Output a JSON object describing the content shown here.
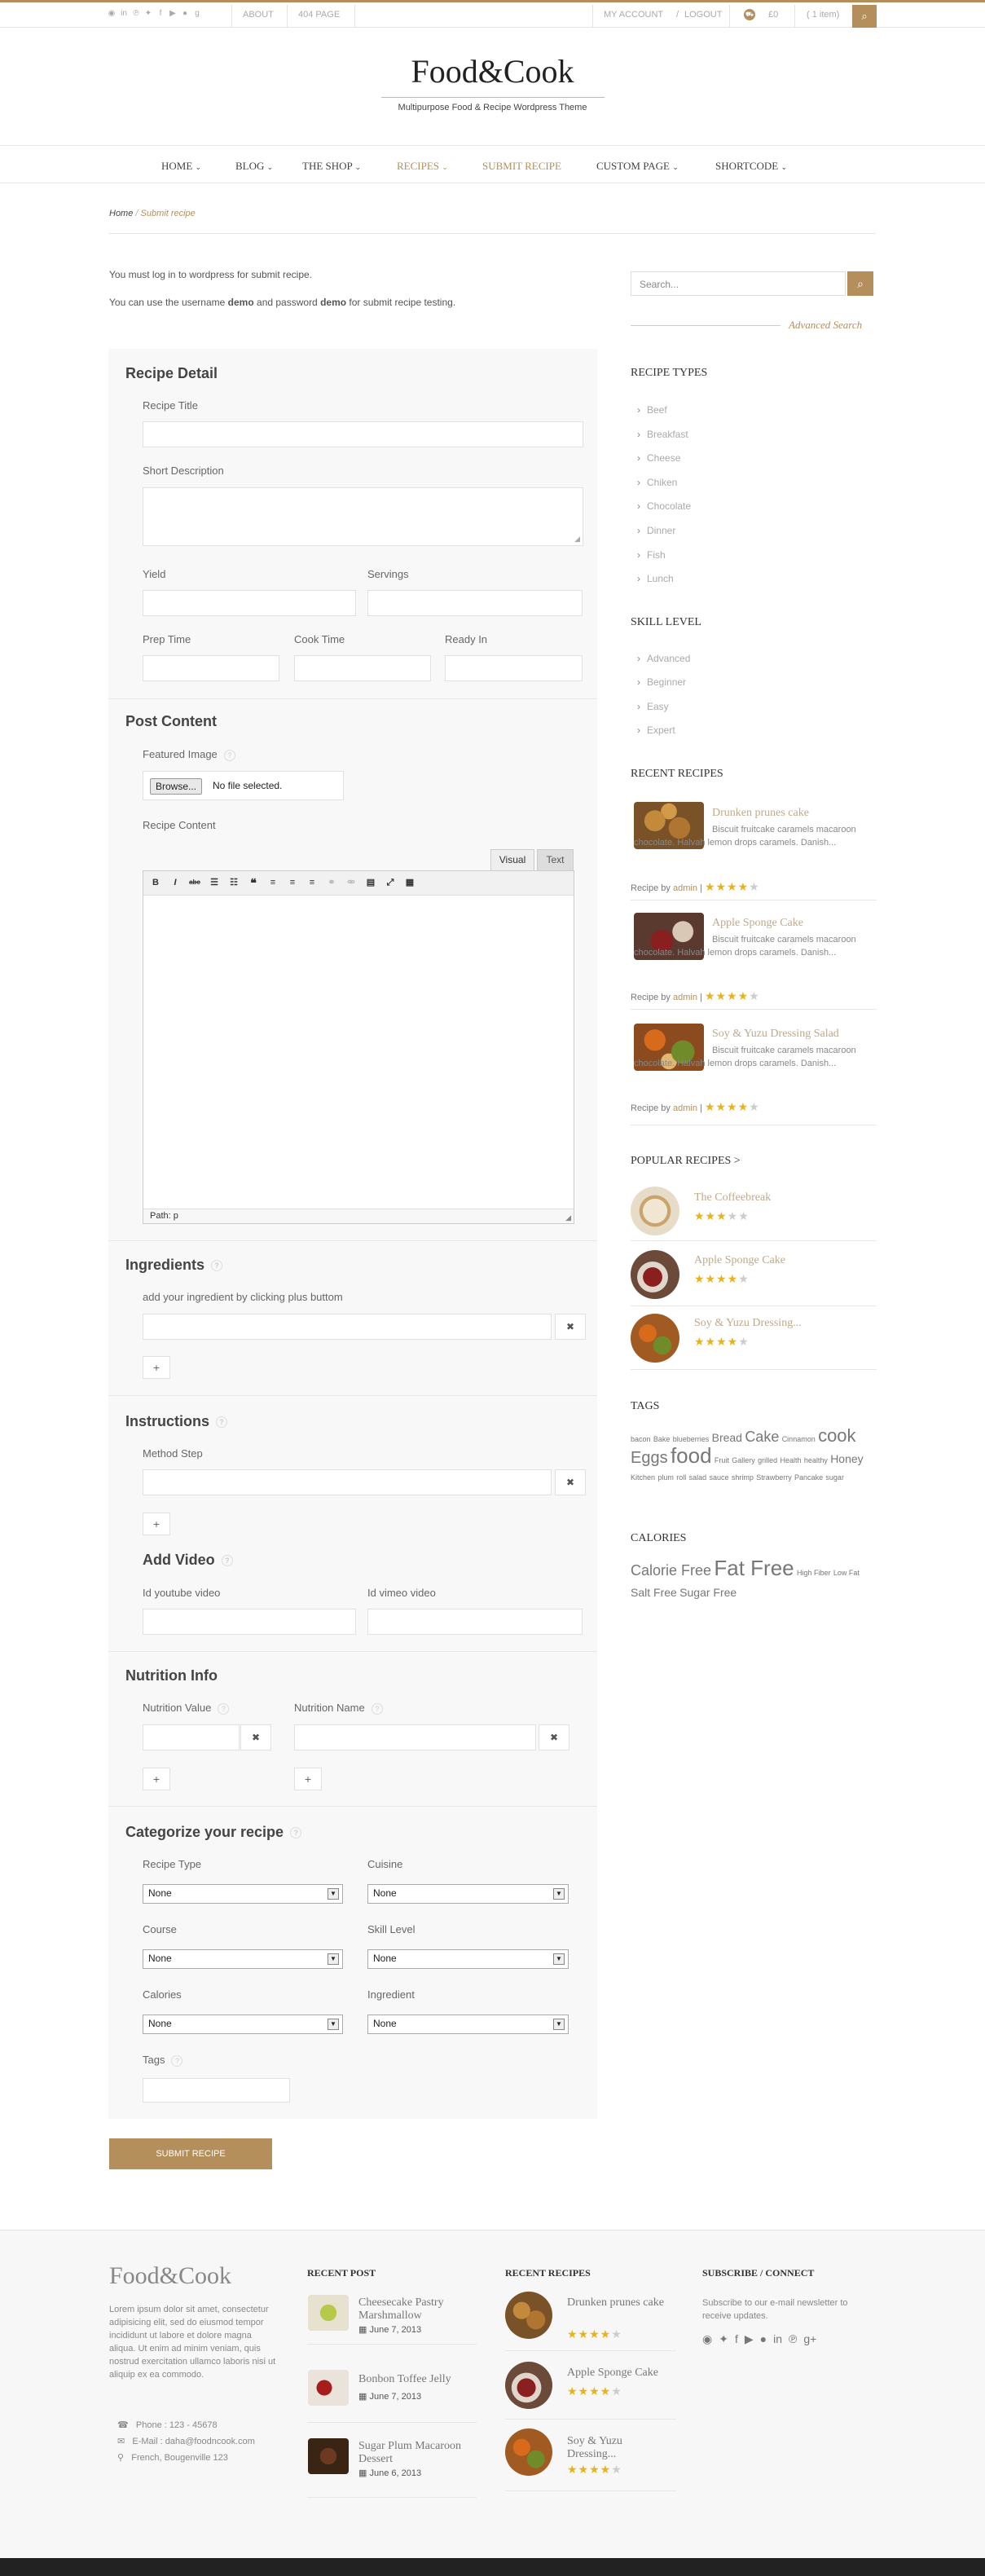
{
  "topbar": {
    "social_icons": [
      "rss-icon",
      "linkedin-icon",
      "pinterest-icon",
      "twitter-icon",
      "facebook-icon",
      "youtube-icon",
      "flickr-icon",
      "google-plus-icon"
    ],
    "links": [
      "ABOUT",
      "404 PAGE"
    ],
    "my_account": "MY ACCOUNT",
    "separator": "/",
    "logout": "LOGOUT",
    "cart_total": "£0",
    "cart_items": "( 1 item)"
  },
  "brand": {
    "logo": "Food&Cook",
    "tagline": "Multipurpose Food & Recipe Wordpress Theme"
  },
  "nav": {
    "items": [
      "HOME",
      "BLOG",
      "THE SHOP",
      "RECIPES",
      "SUBMIT RECIPE",
      "CUSTOM PAGE",
      "SHORTCODE"
    ]
  },
  "breadcrumb": {
    "home": "Home",
    "separator": "/",
    "current": "Submit recipe"
  },
  "notice": {
    "line1": "You must log in to wordpress for submit recipe.",
    "line2_a": "You can use the username ",
    "line2_user": "demo",
    "line2_b": " and password ",
    "line2_pass": "demo",
    "line2_c": " for submit recipe testing."
  },
  "form": {
    "recipe_detail": {
      "title": "Recipe Detail",
      "recipe_title": "Recipe Title",
      "short_description": "Short Description",
      "yield": "Yield",
      "servings": "Servings",
      "prep_time": "Prep Time",
      "cook_time": "Cook Time",
      "ready_in": "Ready In"
    },
    "post_content": {
      "title": "Post Content",
      "featured_image": "Featured Image",
      "browse": "Browse...",
      "no_file": "No file selected.",
      "recipe_content": "Recipe Content",
      "visual_tab": "Visual",
      "text_tab": "Text",
      "path": "Path: p",
      "help": "?"
    },
    "ingredients": {
      "title": "Ingredients",
      "hint": "add your ingredient by clicking plus buttom",
      "remove": "✖",
      "add": "+"
    },
    "instructions": {
      "title": "Instructions",
      "method_step": "Method Step"
    },
    "video": {
      "title": "Add Video",
      "youtube": "Id youtube video",
      "vimeo": "Id vimeo video"
    },
    "nutrition": {
      "title": "Nutrition Info",
      "value": "Nutrition Value",
      "name": "Nutrition Name"
    },
    "categorize": {
      "title": "Categorize your recipe",
      "recipe_type": "Recipe Type",
      "cuisine": "Cuisine",
      "course": "Course",
      "skill_level": "Skill Level",
      "calories": "Calories",
      "ingredient": "Ingredient",
      "tags": "Tags",
      "none": "None"
    },
    "submit": "SUBMIT RECIPE"
  },
  "sidebar": {
    "search_placeholder": "Search...",
    "advanced_search": "Advanced Search",
    "recipe_types": {
      "title": "RECIPE TYPES",
      "items": [
        "Beef",
        "Breakfast",
        "Cheese",
        "Chiken",
        "Chocolate",
        "Dinner",
        "Fish",
        "Lunch"
      ]
    },
    "skill_level": {
      "title": "SKILL LEVEL",
      "items": [
        "Advanced",
        "Beginner",
        "Easy",
        "Expert"
      ]
    },
    "recent_recipes": {
      "title": "RECENT RECIPES",
      "by": "Recipe by",
      "author": "admin",
      "items": [
        {
          "title": "Drunken prunes cake",
          "desc": "Biscuit fruitcake caramels macaroon chocolate. Halvah lemon drops caramels. Danish...",
          "rating": 4
        },
        {
          "title": "Apple Sponge Cake",
          "desc": "Biscuit fruitcake caramels macaroon chocolate. Halvah lemon drops caramels. Danish...",
          "rating": 4
        },
        {
          "title": "Soy & Yuzu Dressing Salad",
          "desc": "Biscuit fruitcake caramels macaroon chocolate. Halvah lemon drops caramels. Danish...",
          "rating": 4
        }
      ]
    },
    "popular_recipes": {
      "title": "POPULAR RECIPES >",
      "items": [
        {
          "title": "The Coffeebreak",
          "rating": 3
        },
        {
          "title": "Apple Sponge Cake",
          "rating": 4
        },
        {
          "title": "Soy & Yuzu Dressing...",
          "rating": 4
        }
      ]
    },
    "tags": {
      "title": "TAGS",
      "items": [
        "bacon",
        "Bake",
        "blueberries",
        "Bread",
        "Cake",
        "Cinnamon",
        "cook",
        "Eggs",
        "food",
        "Fruit",
        "Gallery",
        "grilled",
        "Health",
        "healthy",
        "Honey",
        "Kitchen",
        "plum",
        "roll",
        "salad",
        "sauce",
        "shrimp",
        "Strawberry",
        "Pancake",
        "sugar"
      ]
    },
    "calories": {
      "title": "CALORIES",
      "items": [
        "Calorie Free",
        "Fat Free",
        "High Fiber",
        "Low Fat",
        "Salt Free",
        "Sugar Free"
      ]
    }
  },
  "footer": {
    "logo": "Food&Cook",
    "about": "Lorem ipsum dolor sit amet, consectetur adipisicing elit, sed do eiusmod tempor incididunt ut labore et dolore magna aliqua. Ut enim ad minim veniam, quis nostrud exercitation ullamco laboris nisi ut aliquip ex ea commodo.",
    "phone": "Phone : 123 - 45678",
    "email": "E-Mail : daha@foodncook.com",
    "address": "French, Bougenville 123",
    "recent_post": {
      "title": "RECENT POST",
      "items": [
        {
          "title": "Cheesecake Pastry Marshmallow",
          "date": "June 7, 2013"
        },
        {
          "title": "Bonbon Toffee Jelly",
          "date": "June 7, 2013"
        },
        {
          "title": "Sugar Plum Macaroon Dessert",
          "date": "June 6, 2013"
        }
      ]
    },
    "recent_recipes": {
      "title": "RECENT RECIPES",
      "items": [
        {
          "title": "Drunken prunes cake",
          "rating": 4
        },
        {
          "title": "Apple Sponge Cake",
          "rating": 4
        },
        {
          "title": "Soy & Yuzu Dressing...",
          "rating": 4
        }
      ]
    },
    "subscribe": {
      "title": "SUBSCRIBE / CONNECT",
      "text": "Subscribe to our e-mail newsletter to receive updates."
    }
  },
  "colors": {
    "accent": "#b48f5b",
    "star": "#e8b21b",
    "footer_bg": "#f7f7f7",
    "bottom_bar": "#222222"
  }
}
